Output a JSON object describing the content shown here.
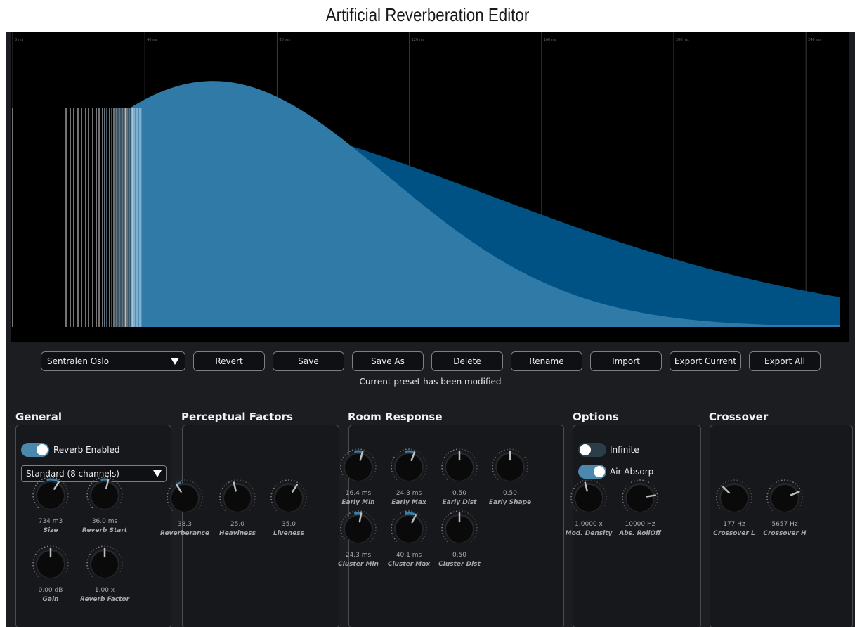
{
  "window_title": "Artificial Reverberation Editor",
  "plot": {
    "time_labels": [
      "0 ms",
      "40 ms",
      "80 ms",
      "120 ms",
      "160 ms",
      "200 ms",
      "240 ms"
    ]
  },
  "toolbar": {
    "preset": "Sentralen Oslo",
    "buttons": [
      "Revert",
      "Save",
      "Save As",
      "Delete",
      "Rename",
      "Import",
      "Export Current",
      "Export All"
    ],
    "status": "Current preset has been modified"
  },
  "sections": {
    "general": "General",
    "perceptual": "Perceptual Factors",
    "room": "Room Response",
    "options": "Options",
    "crossover": "Crossover"
  },
  "general": {
    "reverb_enabled_label": "Reverb Enabled",
    "reverb_enabled": true,
    "channel_mode": "Standard (8 channels)"
  },
  "options": {
    "infinite_label": "Infinite",
    "infinite": false,
    "air_absorp_label": "Air Absorp",
    "air_absorp": true
  },
  "knobs": {
    "size": {
      "value": "734 m3",
      "name": "Size",
      "level": 0.62,
      "arc": true
    },
    "reverb_start": {
      "value": "36.0 ms",
      "name": "Reverb Start",
      "level": 0.55,
      "arc": true
    },
    "gain": {
      "value": "0.00 dB",
      "name": "Gain",
      "level": 0.5,
      "arc": false
    },
    "reverb_factor": {
      "value": "1.00 x",
      "name": "Reverb Factor",
      "level": 0.5,
      "arc": false
    },
    "reverberance": {
      "value": "38.3",
      "name": "Reverberance",
      "level": 0.38,
      "arc": true
    },
    "heaviness": {
      "value": "25.0",
      "name": "Heaviness",
      "level": 0.45,
      "arc": false
    },
    "liveness": {
      "value": "35.0",
      "name": "Liveness",
      "level": 0.62,
      "arc": false
    },
    "early_min": {
      "value": "16.4 ms",
      "name": "Early Min",
      "level": 0.56,
      "arc": true
    },
    "early_max": {
      "value": "24.3 ms",
      "name": "Early Max",
      "level": 0.58,
      "arc": true
    },
    "early_dist": {
      "value": "0.50",
      "name": "Early Dist",
      "level": 0.5,
      "arc": false
    },
    "early_shape": {
      "value": "0.50",
      "name": "Early Shape",
      "level": 0.5,
      "arc": false
    },
    "cluster_min": {
      "value": "24.3 ms",
      "name": "Cluster Min",
      "level": 0.54,
      "arc": true
    },
    "cluster_max": {
      "value": "40.1 ms",
      "name": "Cluster Max",
      "level": 0.6,
      "arc": true
    },
    "cluster_dist": {
      "value": "0.50",
      "name": "Cluster Dist",
      "level": 0.5,
      "arc": false
    },
    "mod_density": {
      "value": "1.0000 x",
      "name": "Mod. Density",
      "level": 0.45,
      "arc": false
    },
    "abs_rolloff": {
      "value": "10000 Hz",
      "name": "Abs. RollOff",
      "level": 0.8,
      "arc": false
    },
    "crossover_l": {
      "value": "177 Hz",
      "name": "Crossover L",
      "level": 0.33,
      "arc": false
    },
    "crossover_h": {
      "value": "5657 Hz",
      "name": "Crossover H",
      "level": 0.75,
      "arc": false
    }
  },
  "colors": {
    "accent": "#3a7fa8",
    "decay_dark": "#005284",
    "decay_light": "#2f7aa6",
    "toggle_on": "#4a88ad",
    "toggle_off": "#2c3d4a"
  }
}
